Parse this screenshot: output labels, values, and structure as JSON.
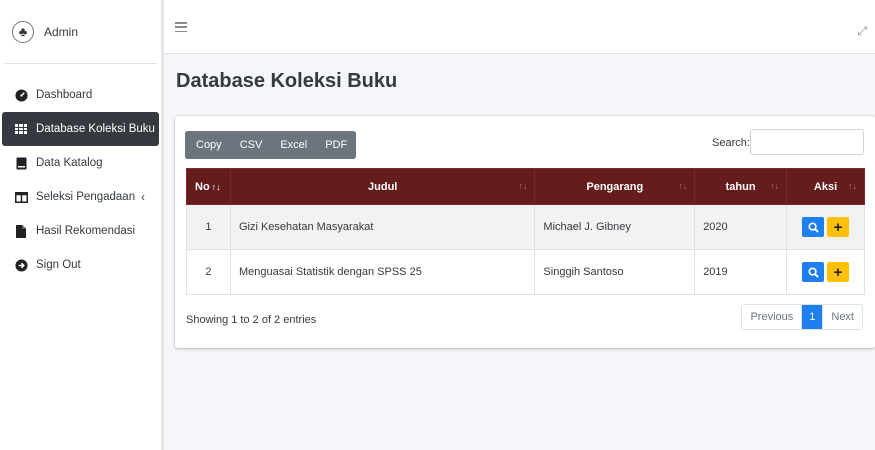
{
  "sidebar": {
    "user": "Admin",
    "items": [
      {
        "label": "Dashboard",
        "icon": "dashboard-icon"
      },
      {
        "label": "Database Koleksi Buku",
        "icon": "table-icon",
        "active": true
      },
      {
        "label": "Data Katalog",
        "icon": "book-icon"
      },
      {
        "label": "Seleksi Pengadaan",
        "icon": "columns-icon",
        "has_submenu": true
      },
      {
        "label": "Hasil Rekomendasi",
        "icon": "file-icon"
      },
      {
        "label": "Sign Out",
        "icon": "sign-out-icon"
      }
    ],
    "chevron": "‹"
  },
  "header": {
    "page_title": "Database Koleksi Buku"
  },
  "toolbar": {
    "copy_label": "Copy",
    "csv_label": "CSV",
    "excel_label": "Excel",
    "pdf_label": "PDF",
    "search_label": "Search:",
    "search_value": ""
  },
  "table": {
    "columns": [
      "No",
      "Judul",
      "Pengarang",
      "tahun",
      "Aksi"
    ],
    "rows": [
      {
        "no": "1",
        "judul": "Gizi Kesehatan Masyarakat",
        "pengarang": "Michael J. Gibney",
        "tahun": "2020"
      },
      {
        "no": "2",
        "judul": "Menguasai Statistik dengan SPSS 25",
        "pengarang": "Singgih Santoso",
        "tahun": "2019"
      }
    ]
  },
  "footer": {
    "info": "Showing 1 to 2 of 2 entries",
    "previous": "Previous",
    "current_page": "1",
    "next": "Next"
  },
  "colors": {
    "header_bg": "#641c1c",
    "active_nav_bg": "#343a40",
    "primary": "#1e7ff0",
    "warning": "#ffc107",
    "button_gray": "#6c757d"
  }
}
